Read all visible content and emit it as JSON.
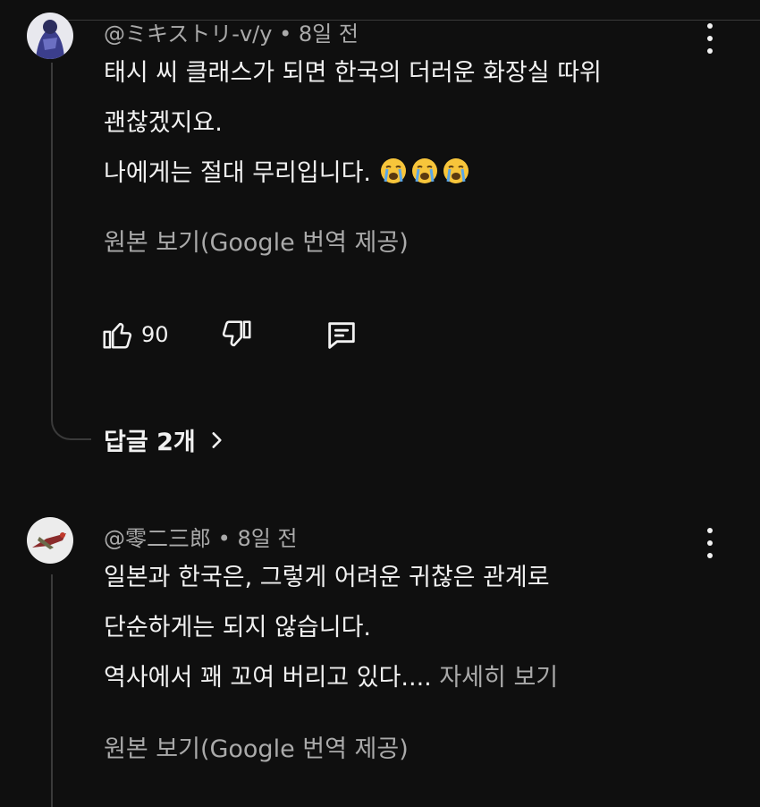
{
  "comments": [
    {
      "author": "@ミキストリ-v/y",
      "time": "8일 전",
      "lines": [
        "태시 씨 클래스가 되면 한국의 더러운 화장실 따위",
        "괜찮겠지요.",
        "나에게는 절대 무리입니다."
      ],
      "emoji": [
        "crying-face-icon",
        "crying-face-icon",
        "crying-face-icon"
      ],
      "translate_label": "원본 보기(Google 번역 제공)",
      "like_count": "90",
      "replies_label": "답글 2개"
    },
    {
      "author": "@零二三郎",
      "time": "8일 전",
      "lines": [
        "일본과 한국은, 그렇게 어려운 귀찮은 관계로",
        "단순하게는 되지 않습니다.",
        "역사에서 꽤 꼬여 버리고 있다...."
      ],
      "more_label": "자세히 보기",
      "translate_label": "원본 보기(Google 번역 제공)"
    }
  ],
  "separator": "•",
  "colors": {
    "background": "#0f0f0f",
    "text": "#f1f1f1",
    "secondary": "#aaaaaa",
    "emoji": "#f7c53b",
    "tears": "#5aa7e8"
  }
}
